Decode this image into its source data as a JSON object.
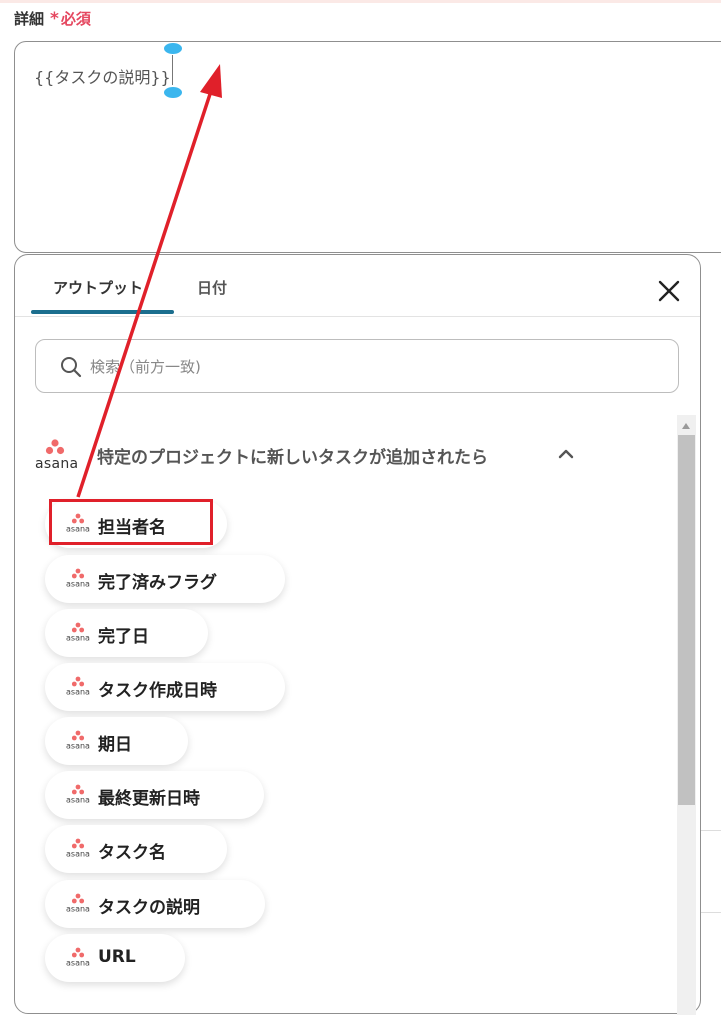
{
  "field": {
    "label": "詳細",
    "required_mark": "*",
    "required_text": "必須"
  },
  "textarea": {
    "value": "{{タスクの説明}}"
  },
  "tabs": [
    {
      "label": "アウトプット",
      "active": true
    },
    {
      "label": "日付",
      "active": false
    }
  ],
  "search": {
    "placeholder": "検索（前方一致)",
    "value": ""
  },
  "group": {
    "logo_text": "asana",
    "title": "特定のプロジェクトに新しいタスクが追加されたら",
    "expanded": true
  },
  "items": [
    {
      "logo_text": "asana",
      "label": "担当者名"
    },
    {
      "logo_text": "asana",
      "label": "完了済みフラグ"
    },
    {
      "logo_text": "asana",
      "label": "完了日"
    },
    {
      "logo_text": "asana",
      "label": "タスク作成日時"
    },
    {
      "logo_text": "asana",
      "label": "期日"
    },
    {
      "logo_text": "asana",
      "label": "最終更新日時"
    },
    {
      "logo_text": "asana",
      "label": "タスク名"
    },
    {
      "logo_text": "asana",
      "label": "タスクの説明"
    },
    {
      "logo_text": "asana",
      "label": "URL"
    }
  ],
  "colors": {
    "required": "#e5475f",
    "tab_underline": "#1b6e8e",
    "asana_logo": "#f06a6a",
    "annotation": "#e0202a",
    "text_handle": "#3bb6ee"
  },
  "icons": {
    "close": "close-icon",
    "search": "search-icon",
    "chevron": "chevron-up-icon",
    "brand": "asana-logo-icon"
  }
}
